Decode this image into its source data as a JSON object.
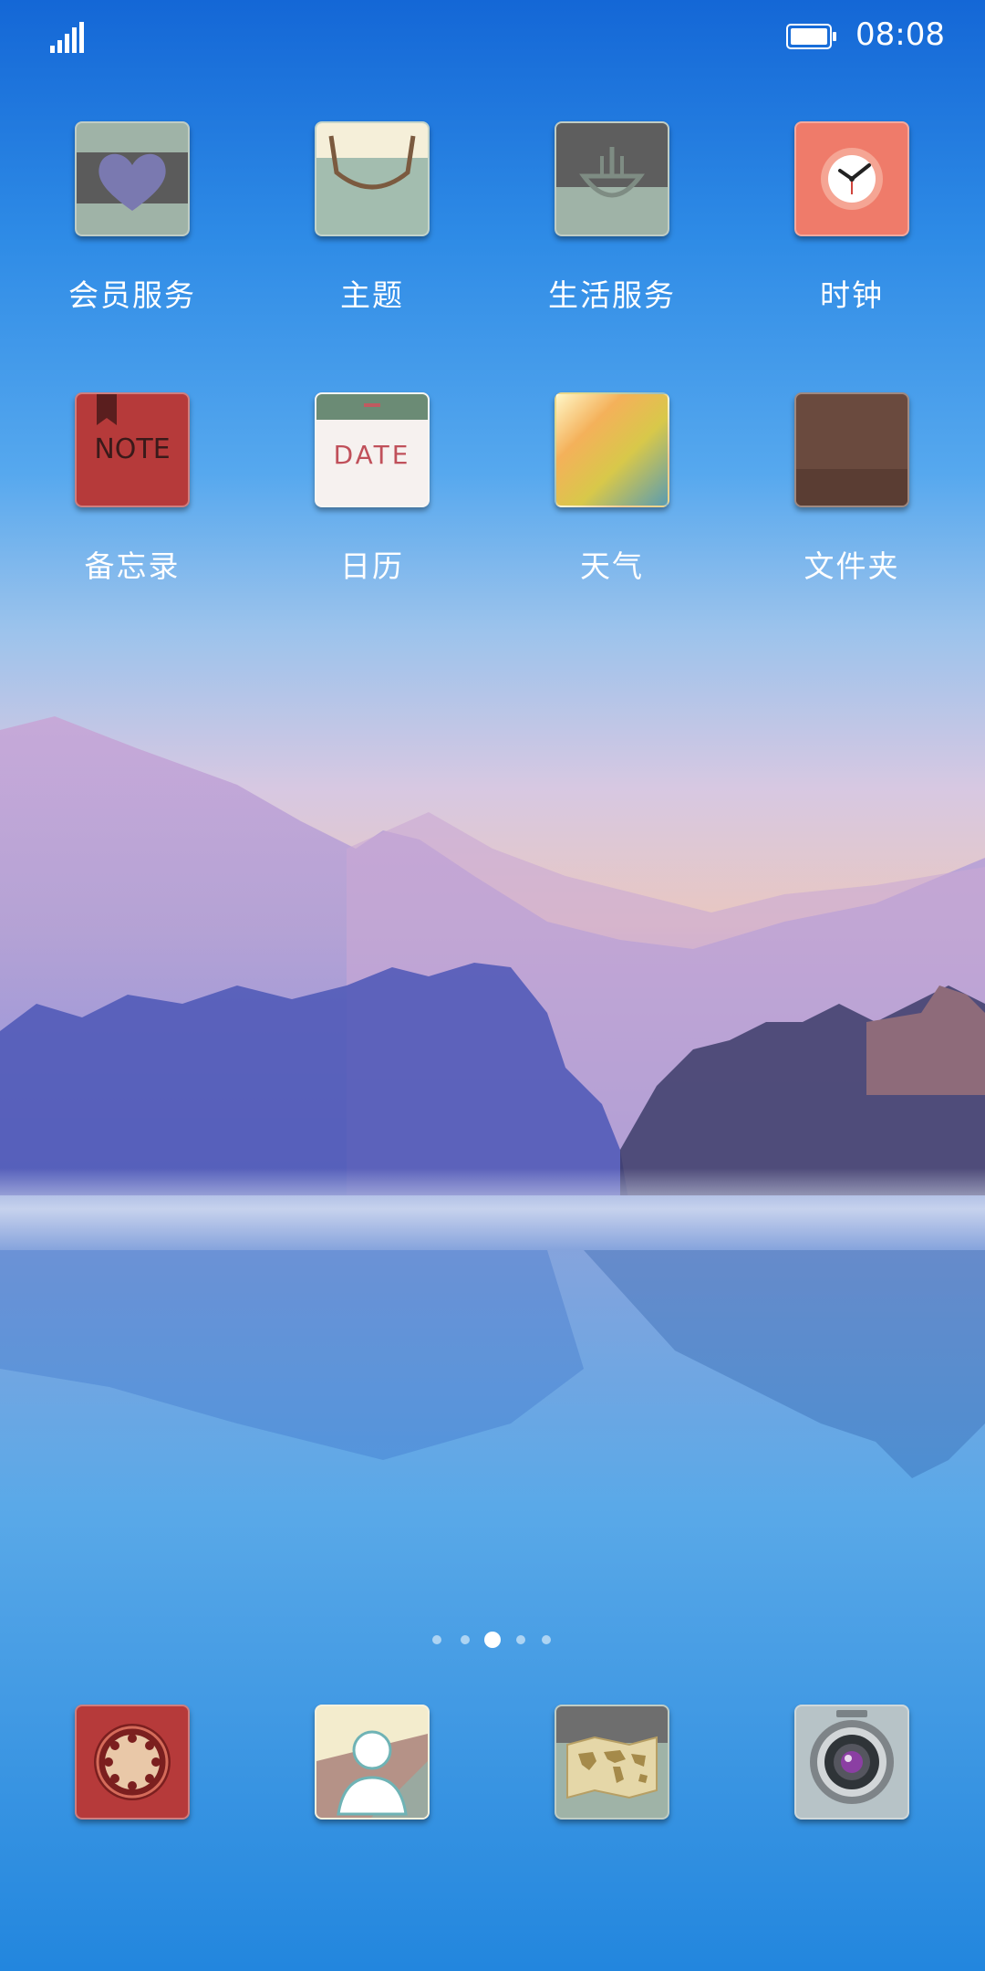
{
  "status": {
    "time": "08:08"
  },
  "apps": [
    {
      "label": "会员服务"
    },
    {
      "label": "主题"
    },
    {
      "label": "生活服务"
    },
    {
      "label": "时钟"
    },
    {
      "label": "备忘录",
      "glyph": "NOTE"
    },
    {
      "label": "日历",
      "glyph": "DATE"
    },
    {
      "label": "天气"
    },
    {
      "label": "文件夹"
    }
  ],
  "pages": {
    "count": 5,
    "active_index": 2
  },
  "colors": {
    "accent": "#ffffff",
    "note": "#b63a3a",
    "clock": "#ef7b6a",
    "folder": "#6a4a3e"
  }
}
